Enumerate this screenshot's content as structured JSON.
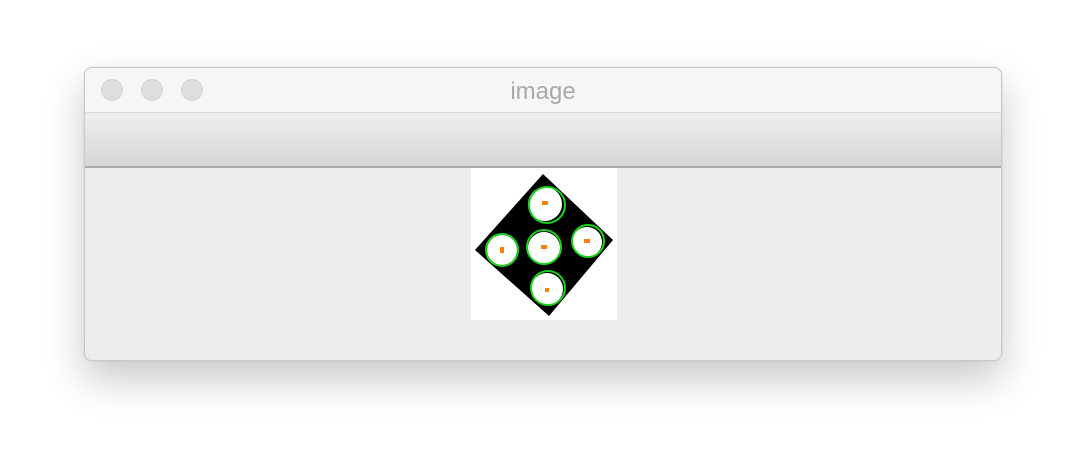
{
  "window": {
    "title": "image"
  },
  "image_content": {
    "description_icon": "dice-five-icon",
    "colors": {
      "die": "#000000",
      "pip": "#ffffff",
      "circle": "#19d219",
      "center_mark": "#ff8000"
    }
  }
}
